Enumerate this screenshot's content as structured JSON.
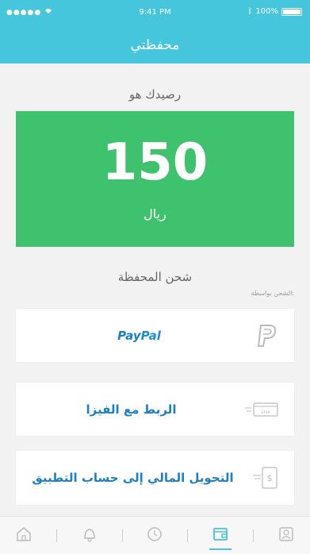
{
  "status_bar": {
    "signal": "●●●●● ",
    "time": "9:41 PM",
    "battery": "100%"
  },
  "header": {
    "title": "محفظتي"
  },
  "balance": {
    "label": "رصيدك هو",
    "amount": "150",
    "currency": "ريال"
  },
  "recharge": {
    "title": "شحن المحفظة",
    "via_label": "الشحن بواسطة:",
    "options": [
      {
        "label_part1": "Pay",
        "label_part2": "Pal",
        "icon": "paypal-icon"
      },
      {
        "label": "الربط مع الفيزا",
        "icon": "visa-card-icon"
      },
      {
        "label": "التحويل المالي إلى حساب التطبيق",
        "icon": "money-transfer-icon"
      }
    ]
  },
  "tab_bar": {
    "items": [
      {
        "icon": "home-icon",
        "active": false
      },
      {
        "icon": "notifications-icon",
        "active": false
      },
      {
        "icon": "orders-icon",
        "active": false
      },
      {
        "icon": "wallet-icon",
        "active": true
      },
      {
        "icon": "profile-icon",
        "active": false
      }
    ]
  },
  "colors": {
    "accent": "#45c6dc",
    "balance_card": "#3fc26e",
    "link_text": "#1c7fc4"
  }
}
